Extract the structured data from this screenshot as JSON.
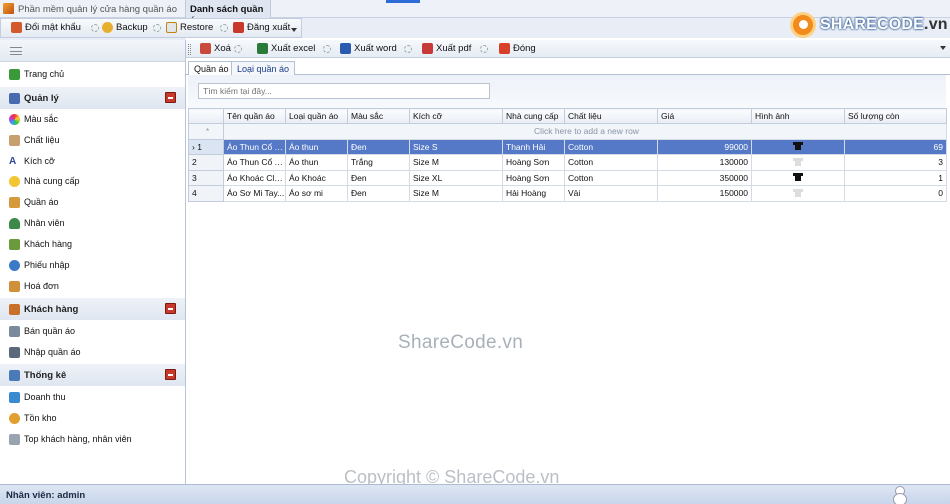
{
  "window": {
    "title": "Phần mềm quản lý cửa hàng quần áo",
    "document_tab": "Danh sách quần áo"
  },
  "toolbar": {
    "change_password": "Đổi mật khẩu",
    "backup": "Backup",
    "restore": "Restore",
    "logout": "Đăng xuất"
  },
  "logo": {
    "brand": "SHARECODE",
    "domain": ".vn"
  },
  "sidebar": {
    "home": "Trang chủ",
    "groups": [
      {
        "label": "Quản lý",
        "items": [
          "Màu sắc",
          "Chất liệu",
          "Kích cỡ",
          "Nhà cung cấp",
          "Quần áo",
          "Nhân viên",
          "Khách hàng",
          "Phiếu nhập",
          "Hoá đơn"
        ]
      },
      {
        "label": "Khách hàng",
        "items": [
          "Bán quần áo",
          "Nhập quần áo"
        ]
      },
      {
        "label": "Thống kê",
        "items": [
          "Doanh thu",
          "Tồn kho",
          "Top khách hàng, nhân viên"
        ]
      }
    ]
  },
  "actions": {
    "delete": "Xoá",
    "export_excel": "Xuất excel",
    "export_word": "Xuất word",
    "export_pdf": "Xuất pdf",
    "close": "Đóng"
  },
  "tabs": [
    "Quần áo",
    "Loại quần áo"
  ],
  "search": {
    "placeholder": "Tìm kiếm tại đây..."
  },
  "grid": {
    "columns": [
      "Tên quần áo",
      "Loại quần áo",
      "Màu sắc",
      "Kích cỡ",
      "Nhà cung cấp",
      "Chất liệu",
      "Giá",
      "Hình ảnh",
      "Số lượng còn"
    ],
    "new_row_text": "Click here to add a new row",
    "rows": [
      {
        "id": "1",
        "name": "Áo Thun Cổ T...",
        "type": "Áo thun",
        "color": "Đen",
        "size": "Size S",
        "supplier": "Thanh Hải",
        "material": "Cotton",
        "price": "99000",
        "image": "shirt-black-icon",
        "qty": "69"
      },
      {
        "id": "2",
        "name": "Áo Thun Cổ T...",
        "type": "Áo thun",
        "color": "Trắng",
        "size": "Size M",
        "supplier": "Hoàng Sơn",
        "material": "Cotton",
        "price": "130000",
        "image": "shirt-white-icon",
        "qty": "3"
      },
      {
        "id": "3",
        "name": "Áo Khoác Cla...",
        "type": "Áo Khoác",
        "color": "Đen",
        "size": "Size XL",
        "supplier": "Hoàng Sơn",
        "material": "Cotton",
        "price": "350000",
        "image": "jacket-black-icon",
        "qty": "1"
      },
      {
        "id": "4",
        "name": "Áo Sơ Mi Tay...",
        "type": "Áo sơ mi",
        "color": "Đen",
        "size": "Size M",
        "supplier": "Hải Hoàng",
        "material": "Vải",
        "price": "150000",
        "image": "shirt-white-icon",
        "qty": "0"
      }
    ],
    "selected_row": "1"
  },
  "watermarks": {
    "center": "ShareCode.vn",
    "bottom": "Copyright © ShareCode.vn"
  },
  "status": {
    "text": "Nhân viên: admin"
  },
  "colors": {
    "selection": "#5579c6",
    "accent": "#2d6bd6",
    "brand_orange": "#f28a1c"
  }
}
